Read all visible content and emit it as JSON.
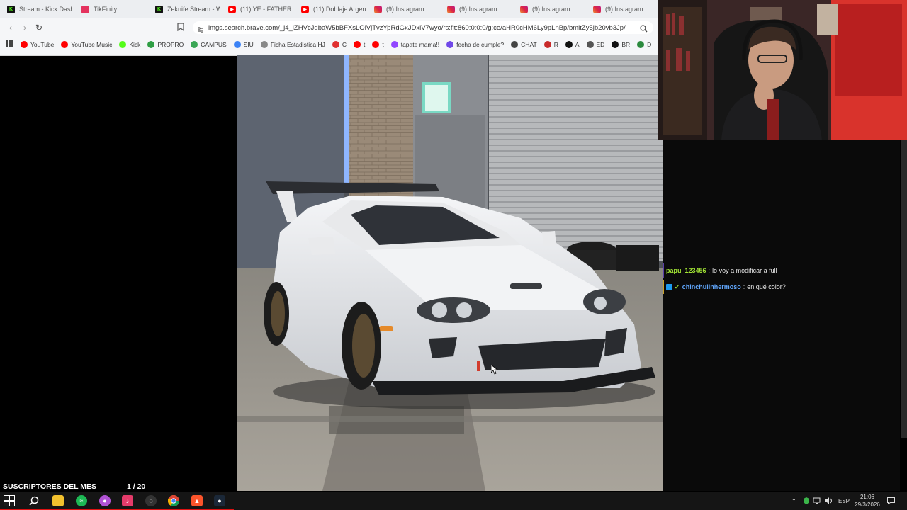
{
  "browser": {
    "tabs": [
      {
        "label": "Stream - Kick Dashb",
        "icon": "kick-icon",
        "color": "#53fc18"
      },
      {
        "label": "TikFinity",
        "icon": "tikfinity-icon",
        "color": "#e4325e"
      },
      {
        "label": "Zeknife Stream - W",
        "icon": "kick-icon",
        "color": "#53fc18"
      },
      {
        "label": "(11) YE - FATHER (fe",
        "icon": "youtube-icon",
        "color": "#ff0000"
      },
      {
        "label": "(11) Doblaje Argent",
        "icon": "youtube-icon",
        "color": "#ff0000"
      },
      {
        "label": "(9) Instagram",
        "icon": "instagram-icon",
        "color": "#d6249f"
      },
      {
        "label": "(9) Instagram",
        "icon": "instagram-icon",
        "color": "#d6249f"
      },
      {
        "label": "(9) Instagram",
        "icon": "instagram-icon",
        "color": "#d6249f"
      },
      {
        "label": "(9) Instagram",
        "icon": "instagram-icon",
        "color": "#d6249f"
      }
    ],
    "url": "imgs.search.brave.com/_j4_lZHVcJdbaW5bBFXsLOiVjTvzYpRdGxJDxlV7wyo/rs:fit:860:0:0:0/g:ce/aHR0cHM6Ly9pLnBp/bmltZy5jb20vb3Jp/Z2luYW...",
    "bookmarks": [
      {
        "label": "YouTube",
        "color": "#ff0000"
      },
      {
        "label": "YouTube Music",
        "color": "#ff0000"
      },
      {
        "label": "Kick",
        "color": "#53fc18"
      },
      {
        "label": "PROPRO",
        "color": "#2f9e44"
      },
      {
        "label": "CAMPUS",
        "color": "#3aa655"
      },
      {
        "label": "SIU",
        "color": "#3b82f6"
      },
      {
        "label": "Ficha Estadistica HJ",
        "color": "#888888"
      },
      {
        "label": "C",
        "color": "#e03131"
      },
      {
        "label": "t",
        "color": "#ff0000"
      },
      {
        "label": "t",
        "color": "#ff0000"
      },
      {
        "label": "tapate mama!!",
        "color": "#9146ff"
      },
      {
        "label": "fecha de cumple?",
        "color": "#7048e8"
      },
      {
        "label": "CHAT",
        "color": "#444444"
      },
      {
        "label": "R",
        "color": "#c92a2a"
      },
      {
        "label": "A",
        "color": "#111111"
      },
      {
        "label": "ED",
        "color": "#555555"
      },
      {
        "label": "BR",
        "color": "#111111"
      },
      {
        "label": "D",
        "color": "#2b8a3e"
      }
    ]
  },
  "chat": {
    "messages": [
      {
        "user": "papu_123456",
        "user_color": "#a3e635",
        "separator": ":",
        "text": "lo voy a modificar a full",
        "highlight": "#5b3fa8"
      },
      {
        "user": "chinchulinhermoso",
        "user_color": "#60a5fa",
        "separator": ":",
        "text": "en qué color?",
        "highlight": "#c9a227"
      }
    ]
  },
  "overlay": {
    "subs_label": "SUSCRIPTORES DEL MES",
    "subs_counter": "1 / 20"
  },
  "taskbar": {
    "language": "ESP",
    "time": "21:06",
    "date": "29/3/2026"
  }
}
